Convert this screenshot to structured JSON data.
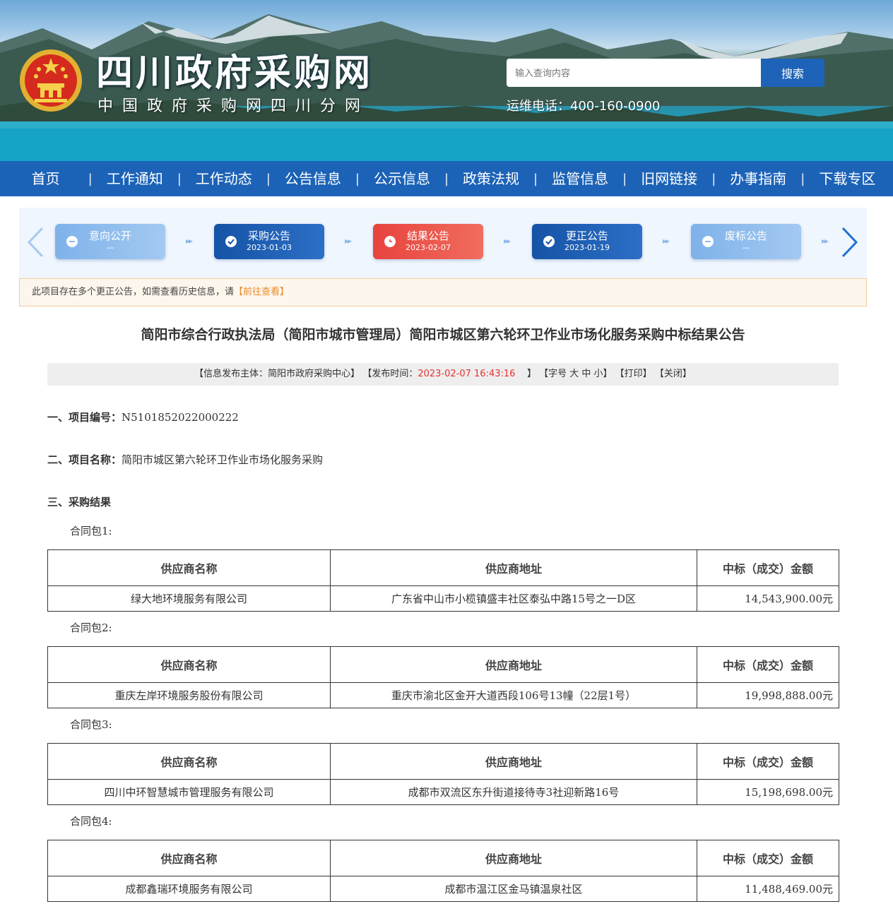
{
  "header": {
    "site_title": "四川政府采购网",
    "site_subtitle": "中国政府采购网四川分网",
    "search_placeholder": "输入查询内容",
    "search_button": "搜索",
    "hotline": "运维电话：400-160-0900"
  },
  "nav": {
    "items": [
      {
        "label": "首页"
      },
      {
        "label": "工作通知"
      },
      {
        "label": "工作动态"
      },
      {
        "label": "公告信息"
      },
      {
        "label": "公示信息"
      },
      {
        "label": "政策法规"
      },
      {
        "label": "监管信息"
      },
      {
        "label": "旧网链接"
      },
      {
        "label": "办事指南"
      },
      {
        "label": "下载专区"
      }
    ]
  },
  "steps": [
    {
      "label": "意向公开",
      "date": "—",
      "state": "minus",
      "color": "light"
    },
    {
      "label": "采购公告",
      "date": "2023-01-03",
      "state": "check",
      "color": "blue"
    },
    {
      "label": "结果公告",
      "date": "2023-02-07",
      "state": "clock",
      "color": "red"
    },
    {
      "label": "更正公告",
      "date": "2023-01-19",
      "state": "check",
      "color": "blue"
    },
    {
      "label": "废标公告",
      "date": "—",
      "state": "minus",
      "color": "light"
    }
  ],
  "notice": {
    "text": "此项目存在多个更正公告，如需查看历史信息，请",
    "link": "【前往查看】"
  },
  "article": {
    "title": "简阳市综合行政执法局（简阳市城市管理局）简阳市城区第六轮环卫作业市场化服务采购中标结果公告",
    "meta": {
      "publisher": "【信息发布主体：简阳市政府采购中心】",
      "time_label": "【发布时间：",
      "time_value": "2023-02-07 16:43:16",
      "time_end": "】",
      "font_size": "【字号 大 中 小】",
      "print": "【打印】",
      "close": "【关闭】"
    },
    "section1_label": "一、项目编号：",
    "section1_value": "N5101852022000222",
    "section2_label": "二、项目名称：",
    "section2_value": "简阳市城区第六轮环卫作业市场化服务采购",
    "section3_label": "三、采购结果",
    "table_headers": [
      "供应商名称",
      "供应商地址",
      "中标（成交）金额"
    ],
    "packages": [
      {
        "label": "合同包1:",
        "supplier": "绿大地环境服务有限公司",
        "address": "广东省中山市小榄镇盛丰社区泰弘中路15号之一D区",
        "amount": "14,543,900.00元"
      },
      {
        "label": "合同包2:",
        "supplier": "重庆左岸环境服务股份有限公司",
        "address": "重庆市渝北区金开大道西段106号13幢（22层1号）",
        "amount": "19,998,888.00元"
      },
      {
        "label": "合同包3:",
        "supplier": "四川中环智慧城市管理服务有限公司",
        "address": "成都市双流区东升街道接待寺3社迎新路16号",
        "amount": "15,198,698.00元"
      },
      {
        "label": "合同包4:",
        "supplier": "成都鑫瑞环境服务有限公司",
        "address": "成都市温江区金马镇温泉社区",
        "amount": "11,488,469.00元"
      }
    ]
  },
  "colors": {
    "nav_blue": "#1c63b7",
    "step_blue": "#1553a6",
    "step_red": "#e8433e",
    "step_light": "#7fb2ea",
    "time_red": "#e8312f",
    "notice_link": "#e98d2a"
  },
  "icons": {
    "emblem": "national-emblem-icon",
    "prev": "chevron-left-icon",
    "next": "chevron-right-icon"
  }
}
